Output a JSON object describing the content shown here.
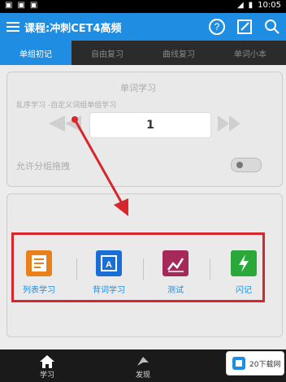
{
  "statusbar": {
    "time": "10:05"
  },
  "appbar": {
    "title": "课程:冲刺CET4高频"
  },
  "tabs": [
    {
      "label": "单组初记"
    },
    {
      "label": "自由复习"
    },
    {
      "label": "曲线复习"
    },
    {
      "label": "单词小本"
    }
  ],
  "top_section": {
    "header": "单词学习",
    "mode_label": "乱序学习 -自定义词组单组学习",
    "number_value": "1",
    "allow_group": "允许分组拖拽"
  },
  "features": [
    {
      "label": "列表学习",
      "icon": "list-study-icon",
      "color": "#e8811b"
    },
    {
      "label": "背词学习",
      "icon": "flash-card-icon",
      "color": "#1a6fd6"
    },
    {
      "label": "测试",
      "icon": "chart-test-icon",
      "color": "#a52a5a"
    },
    {
      "label": "闪记",
      "icon": "lightning-icon",
      "color": "#2aa83a"
    }
  ],
  "bottom_nav": [
    {
      "label": "学习",
      "icon": "home-icon"
    },
    {
      "label": "发现",
      "icon": "discover-icon"
    }
  ],
  "watermark": {
    "text": "20下载网"
  }
}
